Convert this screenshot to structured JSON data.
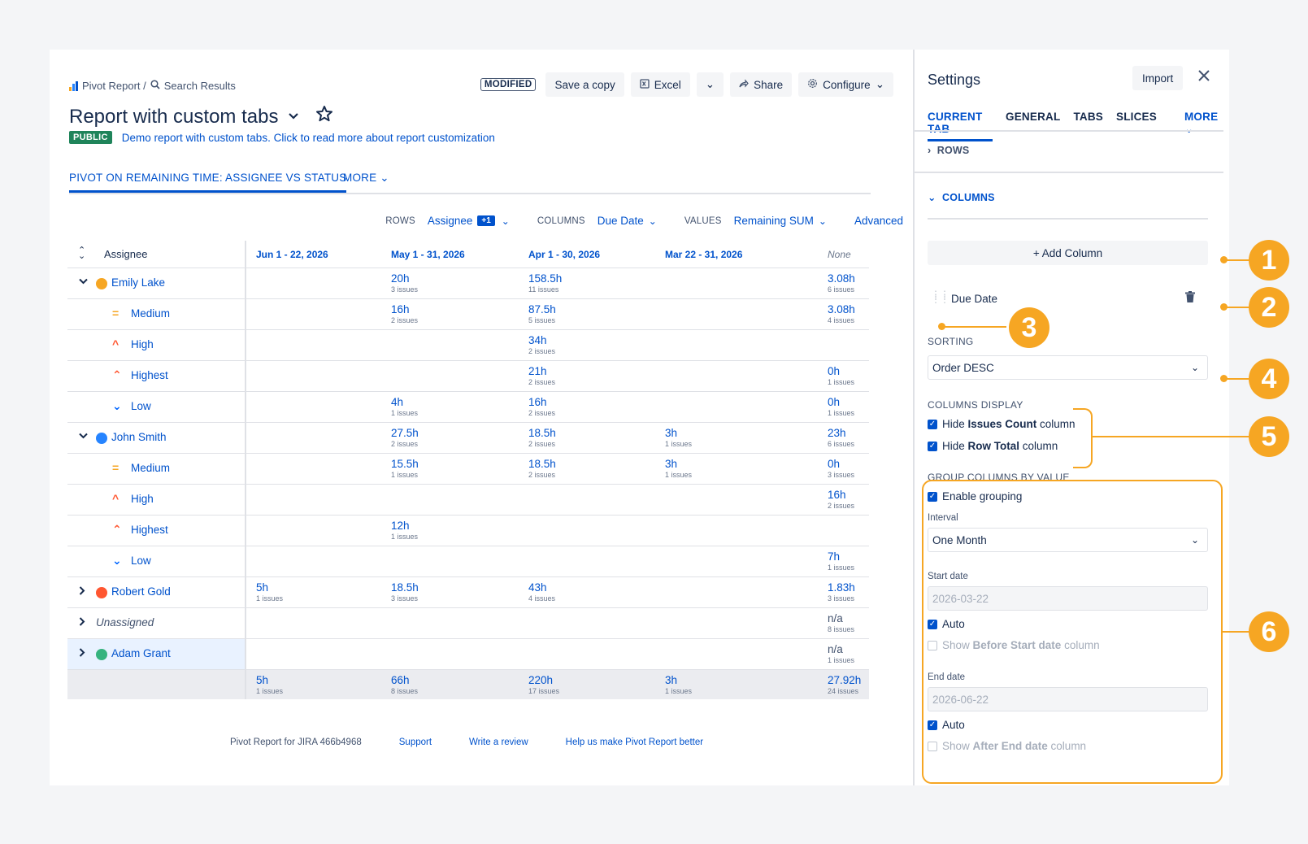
{
  "breadcrumb": {
    "app": "Pivot Report /",
    "search": "Search Results"
  },
  "toolbar": {
    "modified": "MODIFIED",
    "save_copy": "Save a copy",
    "excel": "Excel",
    "share": "Share",
    "configure": "Configure"
  },
  "report": {
    "title": "Report with custom tabs",
    "public": "PUBLIC",
    "description": "Demo report with custom tabs. Click to read more about report customization"
  },
  "tabs": {
    "active": "PIVOT ON REMAINING TIME: ASSIGNEE VS STATUS",
    "more": "MORE"
  },
  "controls": {
    "rows_label": "ROWS",
    "rows_value": "Assignee",
    "rows_extra": "+1",
    "columns_label": "COLUMNS",
    "columns_value": "Due Date",
    "values_label": "VALUES",
    "values_value": "Remaining SUM",
    "advanced": "Advanced"
  },
  "table": {
    "row_header": "Assignee",
    "columns": [
      "Jun 1 - 22, 2026",
      "May 1 - 31, 2026",
      "Apr 1 - 30, 2026",
      "Mar 22 - 31, 2026",
      "None"
    ],
    "rows": [
      {
        "label": "Emily Lake",
        "type": "person",
        "cells": [
          null,
          [
            "20h",
            "3 issues"
          ],
          [
            "158.5h",
            "11 issues"
          ],
          null,
          [
            "3.08h",
            "6 issues"
          ]
        ]
      },
      {
        "label": "Medium",
        "type": "priority",
        "cells": [
          null,
          [
            "16h",
            "2 issues"
          ],
          [
            "87.5h",
            "5 issues"
          ],
          null,
          [
            "3.08h",
            "4 issues"
          ]
        ]
      },
      {
        "label": "High",
        "type": "priority",
        "cells": [
          null,
          null,
          [
            "34h",
            "2 issues"
          ],
          null,
          null
        ]
      },
      {
        "label": "Highest",
        "type": "priority",
        "cells": [
          null,
          null,
          [
            "21h",
            "2 issues"
          ],
          null,
          [
            "0h",
            "1 issues"
          ]
        ]
      },
      {
        "label": "Low",
        "type": "priority",
        "cells": [
          null,
          [
            "4h",
            "1 issues"
          ],
          [
            "16h",
            "2 issues"
          ],
          null,
          [
            "0h",
            "1 issues"
          ]
        ]
      },
      {
        "label": "John Smith",
        "type": "person",
        "cells": [
          null,
          [
            "27.5h",
            "2 issues"
          ],
          [
            "18.5h",
            "2 issues"
          ],
          [
            "3h",
            "1 issues"
          ],
          [
            "23h",
            "6 issues"
          ]
        ]
      },
      {
        "label": "Medium",
        "type": "priority",
        "cells": [
          null,
          [
            "15.5h",
            "1 issues"
          ],
          [
            "18.5h",
            "2 issues"
          ],
          [
            "3h",
            "1 issues"
          ],
          [
            "0h",
            "3 issues"
          ]
        ]
      },
      {
        "label": "High",
        "type": "priority",
        "cells": [
          null,
          null,
          null,
          null,
          [
            "16h",
            "2 issues"
          ]
        ]
      },
      {
        "label": "Highest",
        "type": "priority",
        "cells": [
          null,
          [
            "12h",
            "1 issues"
          ],
          null,
          null,
          null
        ]
      },
      {
        "label": "Low",
        "type": "priority",
        "cells": [
          null,
          null,
          null,
          null,
          [
            "7h",
            "1 issues"
          ]
        ]
      },
      {
        "label": "Robert Gold",
        "type": "person",
        "cells": [
          [
            "5h",
            "1 issues"
          ],
          [
            "18.5h",
            "3 issues"
          ],
          [
            "43h",
            "4 issues"
          ],
          null,
          [
            "1.83h",
            "3 issues"
          ]
        ]
      },
      {
        "label": "Unassigned",
        "type": "unassigned",
        "cells": [
          null,
          null,
          null,
          null,
          [
            "n/a",
            "8 issues"
          ]
        ]
      },
      {
        "label": "Adam Grant",
        "type": "person",
        "cells": [
          null,
          null,
          null,
          null,
          [
            "n/a",
            "1 issues"
          ]
        ]
      }
    ],
    "totals": [
      [
        "5h",
        "1 issues"
      ],
      [
        "66h",
        "8 issues"
      ],
      [
        "220h",
        "17 issues"
      ],
      [
        "3h",
        "1 issues"
      ],
      [
        "27.92h",
        "24 issues"
      ]
    ]
  },
  "footer": {
    "version": "Pivot Report for JIRA 466b4968",
    "support": "Support",
    "review": "Write a review",
    "help": "Help us make Pivot Report better"
  },
  "settings": {
    "title": "Settings",
    "import": "Import",
    "tabs": [
      "CURRENT TAB",
      "GENERAL",
      "TABS",
      "SLICES"
    ],
    "more": "MORE",
    "rows": "ROWS",
    "columns": "COLUMNS",
    "add_column": "+ Add Column",
    "due_date": "Due Date",
    "sorting_label": "SORTING",
    "sorting_value": "Order DESC",
    "columns_display_label": "COLUMNS DISPLAY",
    "hide_issues_prefix": "Hide ",
    "hide_issues_bold": "Issues Count",
    "hide_issues_suffix": " column",
    "hide_total_prefix": "Hide ",
    "hide_total_bold": "Row Total",
    "hide_total_suffix": " column",
    "group_label": "GROUP COLUMNS BY VALUE",
    "enable_grouping": "Enable grouping",
    "interval_label": "Interval",
    "interval_value": "One Month",
    "start_label": "Start date",
    "start_value": "2026-03-22",
    "auto": "Auto",
    "before_prefix": "Show ",
    "before_bold": "Before Start date",
    "before_suffix": " column",
    "end_label": "End date",
    "end_value": "2026-06-22",
    "after_prefix": "Show ",
    "after_bold": "After End date",
    "after_suffix": " column"
  },
  "callouts": [
    "1",
    "2",
    "3",
    "4",
    "5",
    "6"
  ],
  "colors": {
    "accent": "#0052cc",
    "callout": "#f6a623",
    "public": "#1f845a"
  }
}
